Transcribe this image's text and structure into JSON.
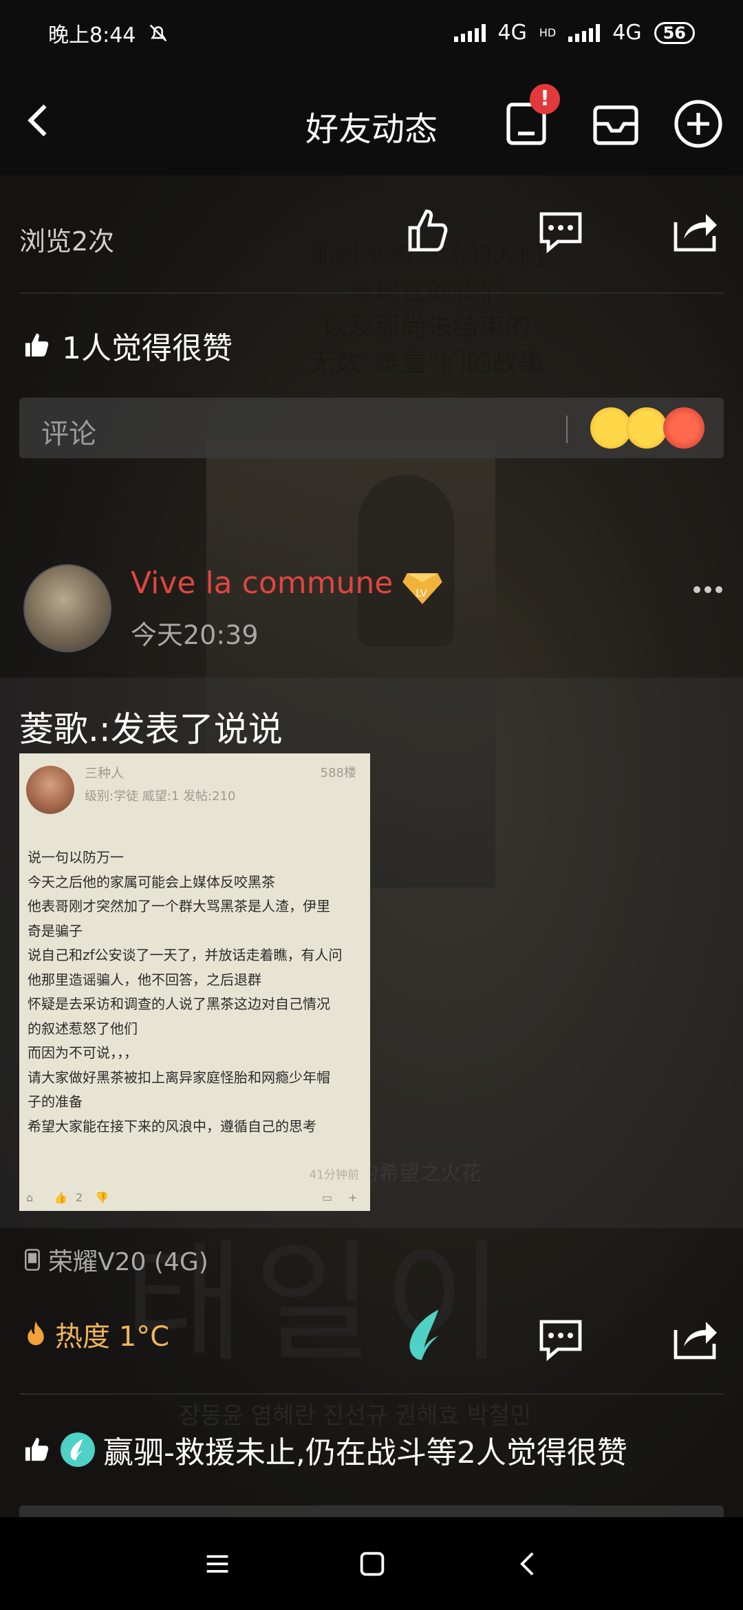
{
  "status_bar": {
    "time": "晚上8:44",
    "network1": "4G",
    "network2": "4G",
    "hd": "HD",
    "battery": "56"
  },
  "header": {
    "title": "好友动态",
    "notification_badge": "!"
  },
  "stats": {
    "views": "浏览2次"
  },
  "likes_summary": "1人觉得很赞",
  "comment_input": {
    "placeholder": "评论"
  },
  "poster": {
    "lines": [
      "那时平和市场的人们",
      "与现在的我们",
      "以及那尚未结束的",
      "无数“泰壹”们的故事"
    ],
    "subtitle": "的希望之火花",
    "hangul": "태일이",
    "cast": "장동윤 염혜란 진선규 권해효 박철민"
  },
  "post": {
    "author": "Vive la commune",
    "time": "今天20:39",
    "shared_title": "菱歌.:发表了说说",
    "card": {
      "username": "三种人",
      "floor": "588楼",
      "meta": "级别:学徒    威望:1    发帖:210",
      "lines": [
        "说一句以防万一",
        "今天之后他的家属可能会上媒体反咬黑茶",
        "他表哥刚才突然加了一个群大骂黑茶是人渣，伊里",
        "奇是骗子",
        "说自己和zf公安谈了一天了，并放话走着瞧，有人问",
        "他那里造谣骗人，他不回答，之后退群",
        "怀疑是去采访和调查的人说了黑茶这边对自己情况",
        "的叙述惹怒了他们",
        "而因为不可说，，，",
        "请大家做好黑茶被扣上离异家庭怪胎和网瘾少年帽",
        "子的准备",
        "希望大家能在接下来的风浪中，遵循自己的思考"
      ],
      "ago": "41分钟前",
      "like_count": "2"
    },
    "device": "荣耀V20 (4G)",
    "heat": "热度 1°C",
    "likes": "赢驷-救援未止,仍在战斗等2人觉得很赞"
  },
  "colors": {
    "accent_red": "#e0463f",
    "heat_orange": "#f2b45a",
    "teal": "#4fd1c5"
  }
}
